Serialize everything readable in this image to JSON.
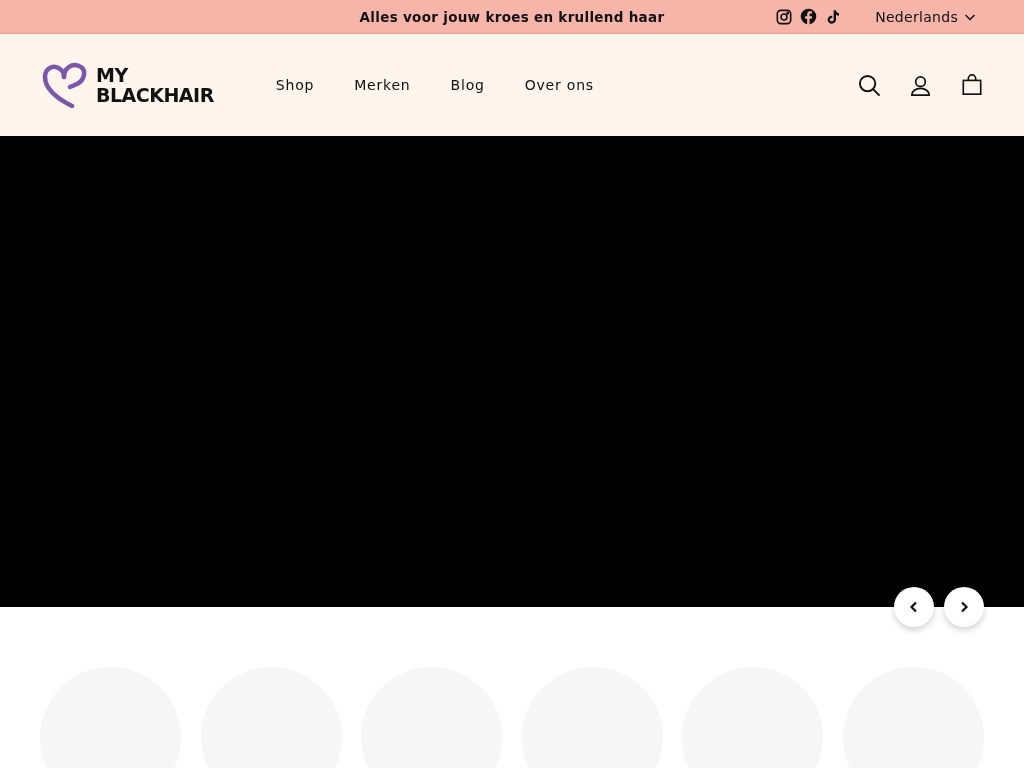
{
  "announcement_bar": {
    "text": "Alles voor jouw kroes en krullend haar",
    "social_links": [
      {
        "kind": "instagram"
      },
      {
        "kind": "facebook"
      },
      {
        "kind": "tiktok"
      }
    ],
    "language": "Nederlands"
  },
  "header": {
    "logo": {
      "line_1": "MY",
      "line_2": "BLACKHAIR"
    },
    "nav": [
      {
        "label": "Shop"
      },
      {
        "label": "Merken"
      },
      {
        "label": "Blog"
      },
      {
        "label": "Over ons"
      }
    ],
    "actions": [
      {
        "kind": "search"
      },
      {
        "kind": "account"
      },
      {
        "kind": "cart"
      }
    ]
  },
  "hero": {
    "controls": [
      {
        "kind": "previous"
      },
      {
        "kind": "next"
      }
    ]
  },
  "category_circles": [
    {
      "kind": "placeholder"
    },
    {
      "kind": "placeholder"
    },
    {
      "kind": "placeholder"
    },
    {
      "kind": "placeholder"
    },
    {
      "kind": "placeholder"
    },
    {
      "kind": "placeholder"
    }
  ]
}
